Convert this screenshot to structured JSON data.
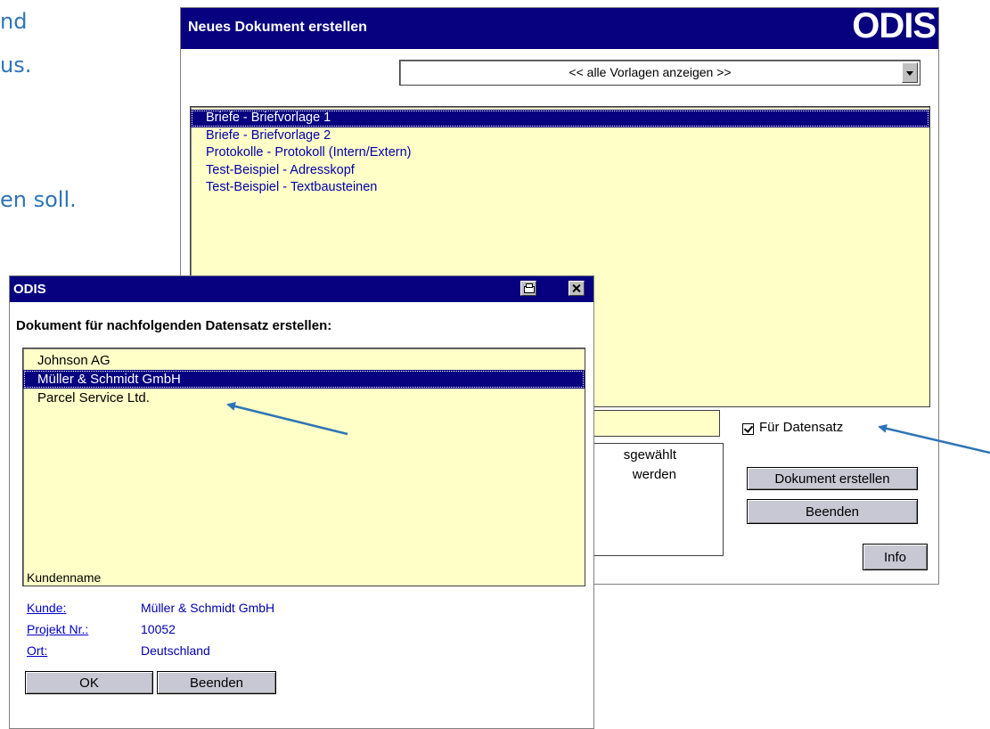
{
  "slide": {
    "lines": [
      "nd",
      "us.",
      "en soll."
    ]
  },
  "main_window": {
    "title": "Neues Dokument erstellen",
    "logo": "ODIS",
    "template_select": {
      "value": "<< alle Vorlagen anzeigen >>"
    },
    "templates": [
      "Briefe  -  Briefvorlage 1",
      "Briefe  -  Briefvorlage 2",
      "Protokolle  -  Protokoll (Intern/Extern)",
      "Test-Beispiel  -  Adresskopf",
      "Test-Beispiel  -  Textbausteinen"
    ],
    "selected_template_index": 0,
    "info_text_line1": "sgewählt",
    "info_text_line2": "werden",
    "checkbox_label": "Für Datensatz",
    "checkbox_checked": true,
    "buttons": {
      "create": "Dokument erstellen",
      "quit": "Beenden",
      "info": "Info"
    }
  },
  "dialog": {
    "title": "ODIS",
    "heading": "Dokument für nachfolgenden Datensatz erstellen:",
    "records": [
      "Johnson AG",
      "Müller & Schmidt GmbH",
      "Parcel Service Ltd."
    ],
    "selected_record_index": 1,
    "section_label": "Kundenname",
    "details": {
      "kunde_label": "Kunde:",
      "kunde_value": "Müller & Schmidt GmbH",
      "projekt_label": "Projekt Nr.:",
      "projekt_value": "10052",
      "ort_label": "Ort:",
      "ort_value": "Deutschland"
    },
    "buttons": {
      "ok": "OK",
      "quit": "Beenden"
    }
  },
  "colors": {
    "title_bar": "#07007f",
    "list_background": "#ffffc8",
    "arrow": "#2e74b5",
    "slide_text": "#2e74b5"
  }
}
